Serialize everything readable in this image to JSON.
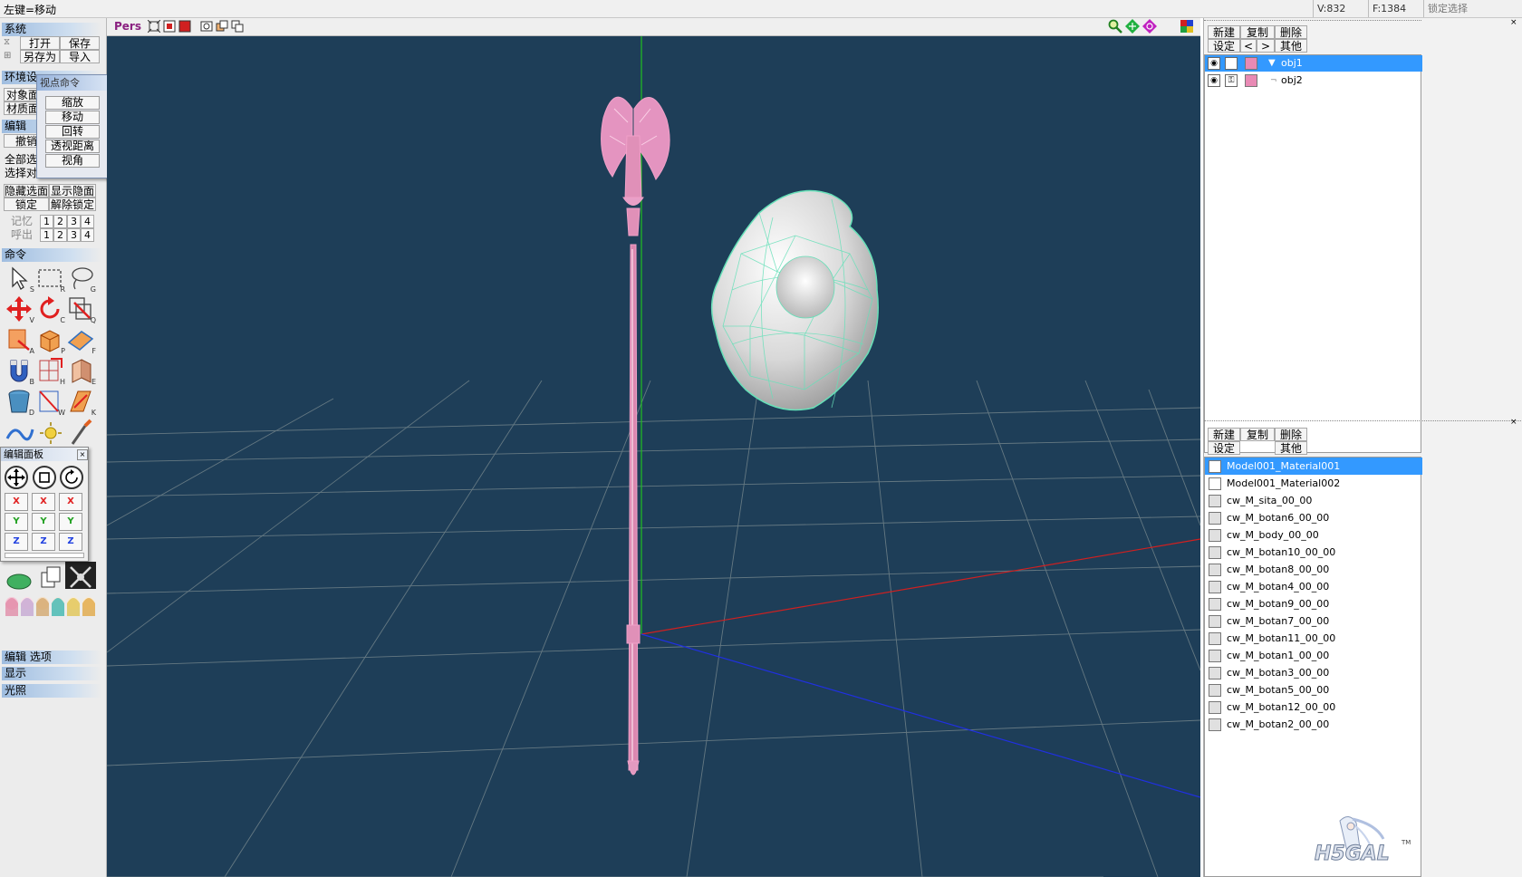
{
  "status": {
    "message": "左键=移动",
    "vertex_count": "V:832",
    "face_count": "F:1384",
    "lock_select": "锁定选择"
  },
  "left": {
    "system_title": "系统",
    "open": "打开",
    "save": "保存",
    "save_as": "另存为",
    "import": "导入",
    "env_title": "环境设",
    "obj_panel": "对象面",
    "mat_panel": "材质面",
    "edit_title": "编辑",
    "undo": "撤销",
    "select_all": "全部选",
    "select_obj": "选择对",
    "hide_face": "隐藏选面",
    "show_hidden": "显示隐面",
    "lock": "锁定",
    "unlock": "解除锁定",
    "memory_label": "记忆",
    "recall_label": "呼出",
    "slots": [
      "1",
      "2",
      "3",
      "4"
    ],
    "command_title": "命令",
    "edit_options": "编辑 选项",
    "display": "显示",
    "lighting": "光照"
  },
  "viewpoint_popup": {
    "title": "视点命令",
    "buttons": [
      "缩放",
      "移动",
      "回转",
      "透视距离",
      "视角"
    ]
  },
  "edit_panel": {
    "title": "编辑面板",
    "axes": [
      "X",
      "Y",
      "Z"
    ]
  },
  "viewport": {
    "mode_label": "Pers"
  },
  "objects": {
    "buttons": {
      "new": "新建",
      "copy": "复制",
      "delete": "删除",
      "settings": "设定",
      "prev": "<",
      "next": ">",
      "other": "其他"
    },
    "items": [
      {
        "name": "obj1",
        "selected": true,
        "color": "#e98ab5"
      },
      {
        "name": "obj2",
        "selected": false,
        "color": "#e98ab5"
      }
    ]
  },
  "materials": {
    "buttons": {
      "new": "新建",
      "copy": "复制",
      "delete": "删除",
      "settings": "设定",
      "other": "其他"
    },
    "items": [
      "Model001_Material001",
      "Model001_Material002",
      "cw_M_sita_00_00",
      "cw_M_botan6_00_00",
      "cw_M_body_00_00",
      "cw_M_botan10_00_00",
      "cw_M_botan8_00_00",
      "cw_M_botan4_00_00",
      "cw_M_botan9_00_00",
      "cw_M_botan7_00_00",
      "cw_M_botan11_00_00",
      "cw_M_botan1_00_00",
      "cw_M_botan3_00_00",
      "cw_M_botan5_00_00",
      "cw_M_botan12_00_00",
      "cw_M_botan2_00_00"
    ]
  },
  "watermark": {
    "text": "H5GAL",
    "tm": "TM"
  },
  "colors": {
    "viewport_bg": "#1e3e58",
    "selection": "#3399ff",
    "staff": "#e98ab5",
    "sphere_wire": "#66e0b8"
  }
}
